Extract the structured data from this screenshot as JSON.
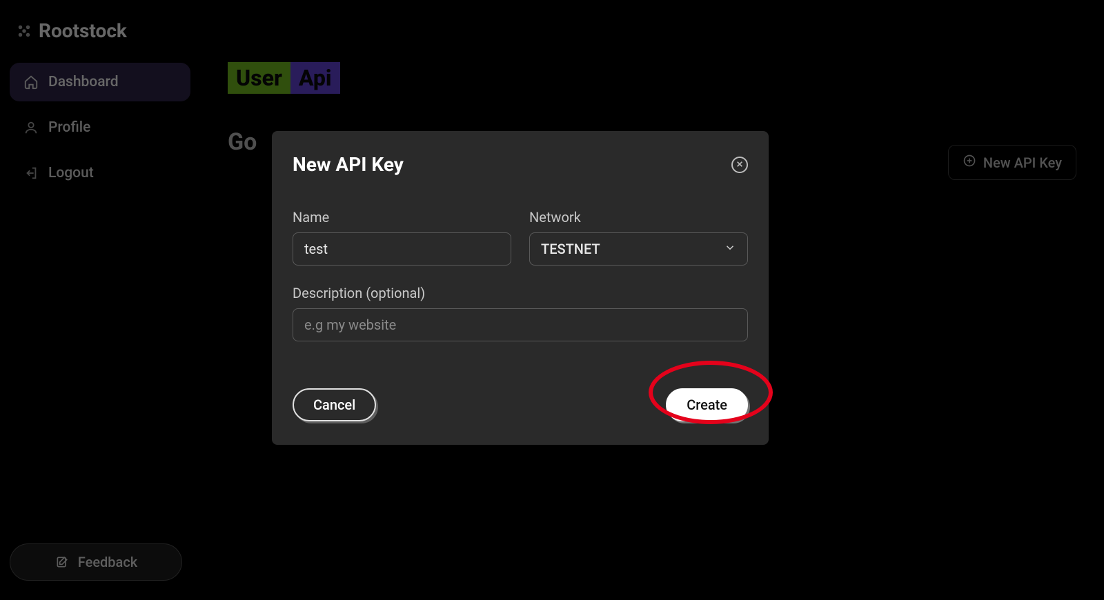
{
  "brand": {
    "name": "Rootstock"
  },
  "sidebar": {
    "items": [
      {
        "label": "Dashboard",
        "icon": "home-icon",
        "active": true
      },
      {
        "label": "Profile",
        "icon": "user-icon",
        "active": false
      },
      {
        "label": "Logout",
        "icon": "logout-icon",
        "active": false
      }
    ],
    "feedback_label": "Feedback"
  },
  "main": {
    "badge_user": "User",
    "badge_api": "Api",
    "greeting_prefix": "Go",
    "new_api_button": "New API Key"
  },
  "modal": {
    "title": "New API Key",
    "fields": {
      "name": {
        "label": "Name",
        "value": "test"
      },
      "network": {
        "label": "Network",
        "selected": "TESTNET"
      },
      "description": {
        "label": "Description (optional)",
        "placeholder": "e.g my website",
        "value": ""
      }
    },
    "actions": {
      "cancel": "Cancel",
      "create": "Create"
    }
  },
  "annotation": {
    "highlight_target": "create-button"
  }
}
